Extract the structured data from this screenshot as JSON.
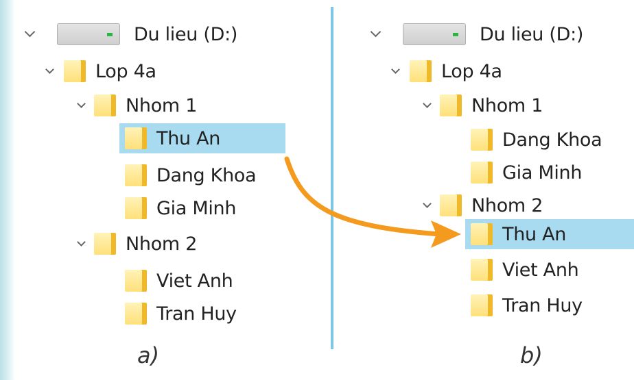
{
  "panel_a": {
    "drive": "Du lieu (D:)",
    "class_folder": "Lop 4a",
    "group1": "Nhom 1",
    "group1_children": [
      "Thu An",
      "Dang Khoa",
      "Gia Minh"
    ],
    "group2": "Nhom 2",
    "group2_children": [
      "Viet Anh",
      "Tran Huy"
    ],
    "caption": "a)"
  },
  "panel_b": {
    "drive": "Du lieu (D:)",
    "class_folder": "Lop 4a",
    "group1": "Nhom 1",
    "group1_children": [
      "Dang Khoa",
      "Gia Minh"
    ],
    "group2": "Nhom 2",
    "group2_children": [
      "Thu An",
      "Viet Anh",
      "Tran Huy"
    ],
    "caption": "b)"
  },
  "colors": {
    "selection": "#a8daf0",
    "divider": "#7cc6e6",
    "arrow": "#f39a1f",
    "folder": "#ffe07a"
  },
  "icons": {
    "drive": "hard-drive-icon",
    "folder": "folder-icon",
    "expand": "chevron-down-icon"
  }
}
